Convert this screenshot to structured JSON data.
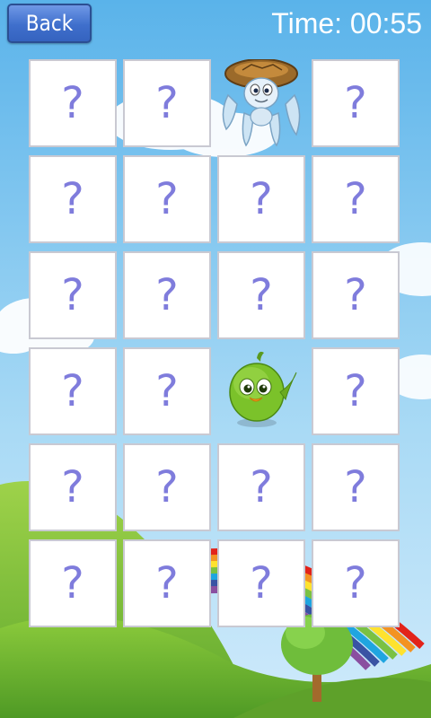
{
  "header": {
    "back_label": "Back",
    "time_label": "Time: 00:55"
  },
  "board": {
    "rows": 6,
    "cols": 4,
    "hidden_symbol": "?",
    "revealed": [
      {
        "row": 0,
        "col": 2,
        "picture": "turtle-icon"
      },
      {
        "row": 3,
        "col": 2,
        "picture": "green-bird-icon"
      }
    ]
  },
  "colors": {
    "sky": "#7cc4ee",
    "grass": "#8cc63e",
    "button_blue": "#3f6fcc",
    "question_mark": "#7f7cdc"
  }
}
